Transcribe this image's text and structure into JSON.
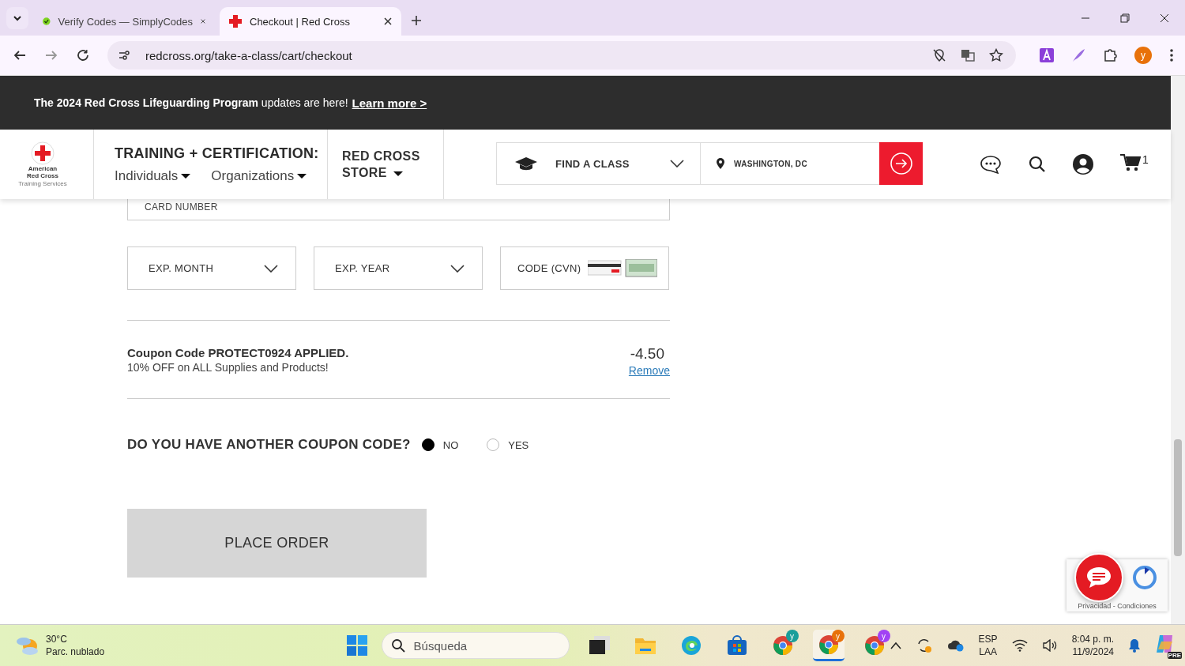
{
  "browser": {
    "tabs": [
      {
        "title": "Verify Codes — SimplyCodes",
        "kind": "verify",
        "selected": false
      },
      {
        "title": "Checkout | Red Cross",
        "kind": "redcross",
        "selected": true
      }
    ],
    "url": "redcross.org/take-a-class/cart/checkout",
    "profile": "y"
  },
  "banner": {
    "text": "**The 2024 Red Cross Lifeguarding Program** updates are here!",
    "link": "Learn more >"
  },
  "header": {
    "logo_lines": [
      "American",
      "Red Cross",
      "Training Services"
    ],
    "training_title": "TRAINING + CERTIFICATION:",
    "menus": [
      "Individuals",
      "Organizations"
    ],
    "store": "RED CROSS STORE",
    "find_class": "FIND A CLASS",
    "location": "WASHINGTON, DC",
    "cart_count": "1"
  },
  "payment": {
    "card_label": "CARD NUMBER",
    "selects": [
      "EXP. MONTH",
      "EXP. YEAR"
    ],
    "cvn_label": "CODE (CVN)"
  },
  "coupon": {
    "title": "Coupon Code PROTECT0924 APPLIED.",
    "description": "10% OFF on ALL Supplies and Products!",
    "amount": "-4.50",
    "remove": "Remove"
  },
  "another_coupon": {
    "question": "DO YOU HAVE ANOTHER COUPON CODE?",
    "options": [
      {
        "label": "NO",
        "selected": true
      },
      {
        "label": "YES",
        "selected": false
      }
    ]
  },
  "place_order": "PLACE ORDER",
  "recaptcha": "Privacidad - Condiciones",
  "taskbar": {
    "temperature": "30°C",
    "condition": "Parc. nublado",
    "search_placeholder": "Búsqueda",
    "apps": [
      {
        "kind": "files-window",
        "selected": false
      },
      {
        "kind": "folder",
        "selected": false
      },
      {
        "kind": "edge",
        "selected": false
      },
      {
        "kind": "store",
        "selected": false
      },
      {
        "kind": "chrome",
        "badge": "y",
        "color": "#1a9e9a",
        "selected": false
      },
      {
        "kind": "chrome",
        "badge": "y",
        "color": "#e8710a",
        "selected": true
      },
      {
        "kind": "chrome",
        "badge": "y",
        "color": "#a142f4",
        "selected": false
      }
    ],
    "language": [
      "ESP",
      "LAA"
    ],
    "time": "8:04 p. m.",
    "date": "11/9/2024",
    "copilot_badge": "PRE"
  }
}
